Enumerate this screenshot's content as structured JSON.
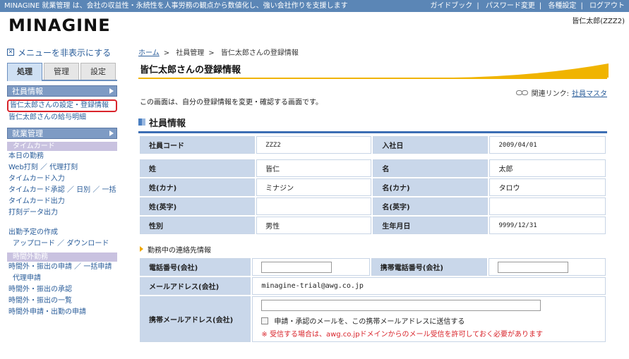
{
  "header": {
    "tagline": "MINAGINE 就業管理 は、会社の収益性・永続性を人事労務の観点から数値化し、強い会社作りを支援します",
    "links": [
      "ガイドブック",
      "パスワード変更",
      "各種設定",
      "ログアウト"
    ],
    "logo": "MINAGINE",
    "user": "皆仁太郎(ZZZ2)"
  },
  "sidebar": {
    "hide_menu": "メニューを非表示にする",
    "tabs": [
      "処理",
      "管理",
      "設定"
    ],
    "employee_info": "社員情報",
    "employee_links": [
      "皆仁太郎さんの設定・登録情報",
      "皆仁太郎さんの給与明細"
    ],
    "work_mgmt": "就業管理",
    "timecard": "タイムカード",
    "timecard_links": [
      "本日の勤務",
      "Web打刻 ／ 代理打刻",
      "タイムカード入力",
      "タイムカード承認 ／ 日別 ／ 一括",
      "タイムカード出力",
      "打刻データ出力"
    ],
    "schedule_links": [
      "出勤予定の作成",
      "アップロード ／ ダウンロード"
    ],
    "overtime": "時間外勤務",
    "overtime_links": [
      "時間外・振出の申請 ／ 一括申請",
      "代理申請",
      "時間外・振出の承認",
      "時間外・振出の一覧",
      "時間外申請・出勤の申請"
    ]
  },
  "main": {
    "breadcrumb": [
      "ホーム",
      "社員管理",
      "皆仁太郎さんの登録情報"
    ],
    "page_title": "皆仁太郎さんの登録情報",
    "related_label": "関連リンク:",
    "related_link": "社員マスタ",
    "description": "この画面は、自分の登録情報を変更・確認する画面です。",
    "section_title": "社員情報",
    "info": {
      "code_label": "社員コード",
      "code": "ZZZ2",
      "join_label": "入社日",
      "join": "2009/04/01",
      "last_label": "姓",
      "last": "皆仁",
      "first_label": "名",
      "first": "太郎",
      "last_kana_label": "姓(カナ)",
      "last_kana": "ミナジン",
      "first_kana_label": "名(カナ)",
      "first_kana": "タロウ",
      "last_en_label": "姓(英字)",
      "last_en": "",
      "first_en_label": "名(英字)",
      "first_en": "",
      "gender_label": "性別",
      "gender": "男性",
      "birth_label": "生年月日",
      "birth": "9999/12/31"
    },
    "contact_title": "勤務中の連絡先情報",
    "contact": {
      "tel_label": "電話番号(会社)",
      "mobile_label": "携帯電話番号(会社)",
      "mail_label": "メールアドレス(会社)",
      "mail": "minagine-trial@awg.co.jp",
      "mobile_mail_label": "携帯メールアドレス(会社)",
      "check_label": "申請・承認のメールを、この携帯メールアドレスに送信する",
      "warning": "※ 受信する場合は、awg.co.jpドメインからのメール受信を許可しておく必要があります"
    }
  },
  "colors": {
    "topbar": "#5b86b6",
    "accent": "#f0b400",
    "link": "#2a5d9a",
    "highlight": "#d9242b",
    "label_bg": "#c9d7ea"
  }
}
